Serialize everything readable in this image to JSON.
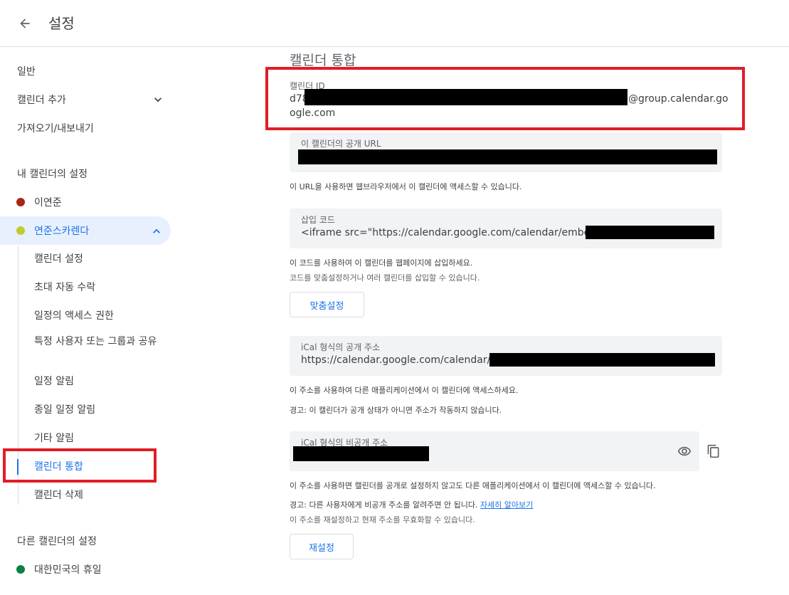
{
  "header": {
    "title": "설정"
  },
  "sidebar": {
    "general": "일반",
    "add_calendar": "캘린더 추가",
    "import_export": "가져오기/내보내기",
    "my_calendars_heading": "내 캘린더의 설정",
    "my_calendars": [
      {
        "name": "이연준",
        "color": "#a52714"
      },
      {
        "name": "연준스카렌다",
        "color": "#c0ca33"
      }
    ],
    "sub_items": [
      "캘린더 설정",
      "초대 자동 수락",
      "일정의 액세스 권한",
      "특정 사용자 또는 그룹과 공유",
      "일정 알림",
      "종일 일정 알림",
      "기타 알림",
      "캘린더 통합",
      "캘린더 삭제"
    ],
    "other_calendars_heading": "다른 캘린더의 설정",
    "other_calendars": [
      {
        "name": "대한민국의 휴일",
        "color": "#0b8043"
      }
    ]
  },
  "main": {
    "section_title": "캘린더 통합",
    "calendar_id": {
      "label": "캘린더 ID",
      "value_prefix": "d78",
      "value_suffix": "@group.calendar.go",
      "value_line2": "ogle.com"
    },
    "public_url": {
      "label": "이 캘린더의 공개 URL",
      "help": "이 URL을 사용하면 웹브라우저에서 이 캘린더에 액세스할 수 있습니다."
    },
    "embed": {
      "label": "삽입 코드",
      "value": "<iframe src=\"https://calendar.google.com/calendar/embed?src=",
      "help1": "이 코드를 사용하여 이 캘린더를 웹페이지에 삽입하세요.",
      "help2": "코드를 맞춤설정하거나 여러 캘린더를 삽입할 수 있습니다.",
      "button": "맞춤설정"
    },
    "ical_public": {
      "label": "iCal 형식의 공개 주소",
      "value": "https://calendar.google.com/calendar/ical",
      "help1": "이 주소를 사용하여 다른 애플리케이션에서 이 캘린더에 액세스하세요.",
      "help2": "경고: 이 캘린더가 공개 상태가 아니면 주소가 작동하지 않습니다."
    },
    "ical_private": {
      "label": "iCal 형식의 비공개 주소",
      "help1": "이 주소를 사용하면 캘린더를 공개로 설정하지 않고도 다른 애플리케이션에서 이 캘린더에 액세스할 수 있습니다.",
      "help2_prefix": "경고: 다른 사용자에게 비공개 주소를 알려주면 안 됩니다.",
      "help2_link": "자세히 알아보기",
      "help3": "이 주소를 재설정하고 현재 주소를 무효화할 수 있습니다.",
      "button": "재설정"
    }
  }
}
